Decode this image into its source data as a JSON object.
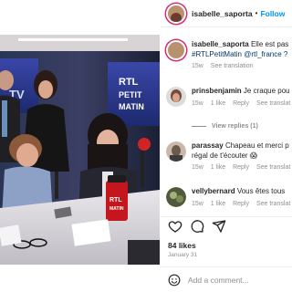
{
  "post": {
    "author": "isabelle_saporta",
    "follow_label": "Follow",
    "separator": "•",
    "photo": {
      "screen_text_line1": "RTL",
      "screen_text_line2": "PETIT",
      "screen_text_line3": "MATIN",
      "left_screen_text": "TV",
      "mug_text_line1": "RTL",
      "mug_text_line2": "MATIN"
    },
    "caption": {
      "user": "isabelle_saporta",
      "text": "Elle est pas",
      "tags": "#RTLPetitMatin @rtl_france ?",
      "age": "15w",
      "see_translation": "See translation"
    },
    "likes": "84 likes",
    "date": "January 31",
    "add_comment_placeholder": "Add a comment..."
  },
  "comments": [
    {
      "user": "prinsbenjamin",
      "text": "Je craque pou",
      "age": "15w",
      "likes": "1 like",
      "reply": "Reply",
      "see_translation": "See translat"
    },
    {
      "user": "parassay",
      "text": "Chapeau et merci p",
      "text2": "régal de t'écouter 😱",
      "age": "15w",
      "likes": "1 like",
      "reply": "Reply",
      "see_translation": "See translat"
    },
    {
      "user": "vellybernard",
      "text": "Vous êtes tous",
      "age": "15w",
      "likes": "1 like",
      "reply": "Reply",
      "see_translation": "See translat"
    }
  ],
  "view_replies": "View replies (1)",
  "icons": {
    "like": "heart-icon",
    "comment": "comment-icon",
    "share": "share-icon",
    "emoji": "emoji-icon"
  },
  "colors": {
    "accent": "#0095f6",
    "muted": "#8e8e8e",
    "hashtag": "#00376b",
    "ring": "#d62976"
  }
}
